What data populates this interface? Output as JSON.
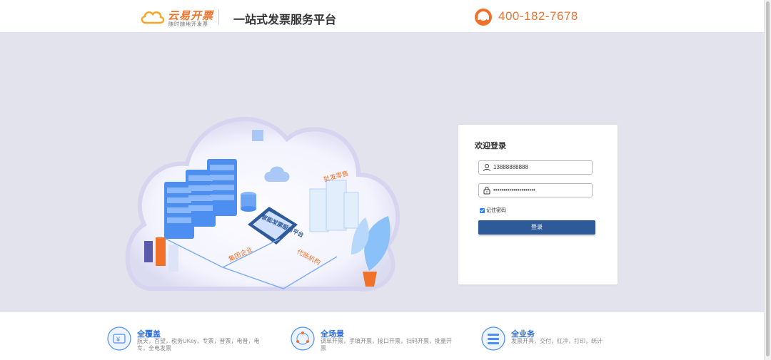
{
  "header": {
    "logo_name": "云易开票",
    "logo_slogan": "随时随地开发票",
    "platform_title": "一站式发票服务平台",
    "phone_number": "400-182-7678",
    "phone_icon": "customer-service-headset-icon"
  },
  "illustration": {
    "labels": {
      "smart_invoice": "智能发票服务平台",
      "wholesale": "批发零售",
      "group": "集团企业",
      "agency": "代账机构"
    }
  },
  "login": {
    "title": "欢迎登录",
    "username_value": "13888888888",
    "password_value": "•••••••••••••••••••••",
    "remember_label": "记住密码",
    "remember_checked": true,
    "submit_label": "登录"
  },
  "features": [
    {
      "icon": "yen-card-icon",
      "title": "全覆盖",
      "desc": "航天，百望，税务UKey，专票，普票，电普，电专，全电发票"
    },
    {
      "icon": "scenario-cycle-icon",
      "title": "全场景",
      "desc": "调单开票，手填开票，接口开票，扫码开票，批量开票"
    },
    {
      "icon": "business-list-icon",
      "title": "全业务",
      "desc": "发票开具，交付，红冲，打印，统计"
    }
  ],
  "colors": {
    "brand_orange": "#f0722a",
    "hero_bg": "#e3e3ee",
    "login_button": "#2f5a9a",
    "feature_blue": "#2d6ee0"
  }
}
